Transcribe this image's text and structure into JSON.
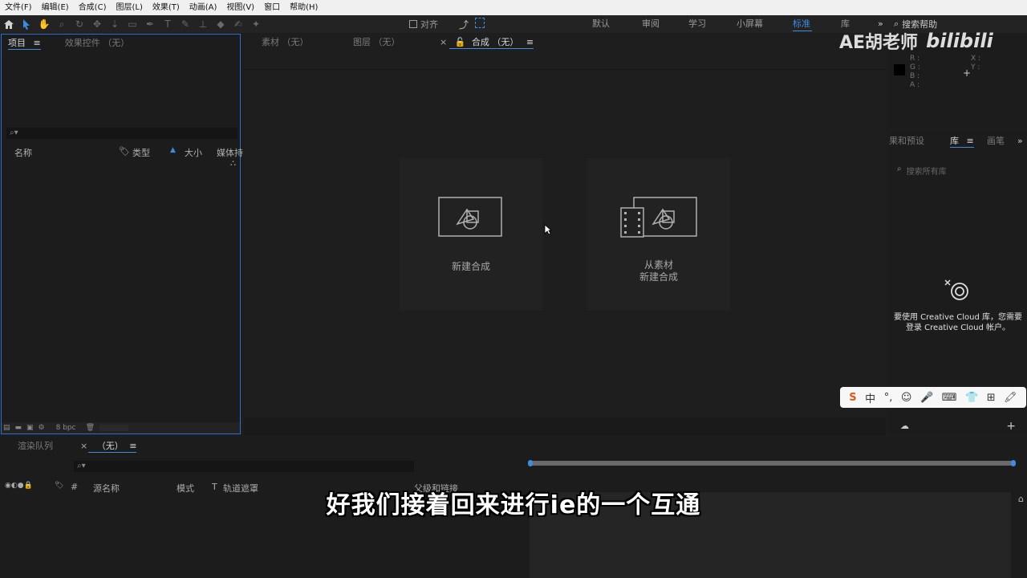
{
  "menu": [
    "文件(F)",
    "编辑(E)",
    "合成(C)",
    "图层(L)",
    "效果(T)",
    "动画(A)",
    "视图(V)",
    "窗口",
    "帮助(H)"
  ],
  "toolbar": {
    "align_label": "对齐",
    "workspaces": [
      "默认",
      "审阅",
      "学习",
      "小屏幕",
      "标准",
      "库"
    ],
    "active_workspace": "标准",
    "search_placeholder": "搜索帮助"
  },
  "project_panel": {
    "tabs": [
      "项目",
      "效果控件 （无）"
    ],
    "columns": [
      "名称",
      "类型",
      "大小",
      "媒体持"
    ],
    "bpc": "8 bpc"
  },
  "viewer": {
    "tabs": [
      "素材 （无）",
      "图层 （无）",
      "合成 （无）"
    ],
    "new_comp_label": "新建合成",
    "from_footage_line1": "从素材",
    "from_footage_line2": "新建合成"
  },
  "info_panel": {
    "channels": [
      "R :",
      "G :",
      "B :",
      "A :"
    ],
    "coords": [
      "X :",
      "Y :"
    ]
  },
  "libraries_panel": {
    "tabs": [
      "果和预设",
      "库",
      "画笔"
    ],
    "search_placeholder": "搜索所有库",
    "message": "要使用 Creative Cloud 库，您需要登录 Creative Cloud 帐户。"
  },
  "timeline": {
    "tabs": [
      "渲染队列",
      "（无）"
    ],
    "columns": [
      "源名称",
      "模式",
      "T",
      "轨道遮罩",
      "父级和链接"
    ]
  },
  "subtitle": "好我们接着回来进行ie的一个互通",
  "watermark": {
    "text": "AE胡老师",
    "logo": "bilibili"
  },
  "ime": [
    "S",
    "中",
    "°,",
    "☺",
    "🎤",
    "⌨",
    "👕",
    "⊞",
    "🖍"
  ]
}
